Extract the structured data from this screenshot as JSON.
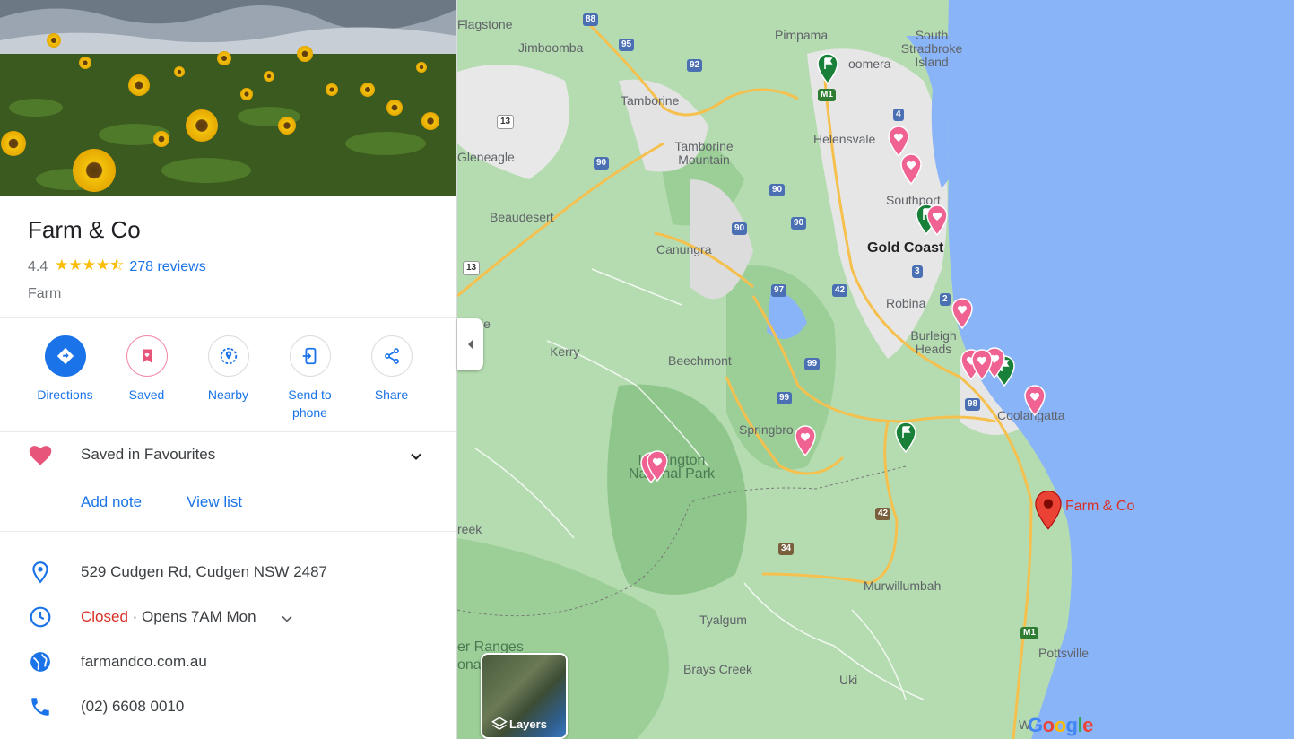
{
  "place": {
    "name": "Farm & Co",
    "rating": "4.4",
    "stars": "★★★★⯪",
    "reviews": "278 reviews",
    "category": "Farm"
  },
  "actions": [
    {
      "label": "Directions",
      "icon": "directions-icon"
    },
    {
      "label": "Saved",
      "icon": "bookmark-icon"
    },
    {
      "label": "Nearby",
      "icon": "nearby-icon"
    },
    {
      "label": "Send to phone",
      "icon": "send-to-phone-icon"
    },
    {
      "label": "Share",
      "icon": "share-icon"
    }
  ],
  "saved": {
    "label": "Saved in Favourites",
    "add_note": "Add note",
    "view_list": "View list"
  },
  "info": {
    "address": "529 Cudgen Rd, Cudgen NSW 2487",
    "hours_status": "Closed",
    "hours_detail": " · Opens 7AM Mon",
    "website": "farmandco.com.au",
    "phone": "(02) 6608 0010"
  },
  "map": {
    "labels": {
      "flagstone": "Flagstone",
      "jimboomba": "Jimboomba",
      "pimpama": "Pimpama",
      "coomera": "oomera",
      "south_stradbroke": "South Stradbroke Island",
      "tamborine": "Tamborine",
      "helensvale": "Helensvale",
      "tamborine_mountain": "Tamborine Mountain",
      "gleneagle": "Gleneagle",
      "southport": "Southport",
      "beaudesert": "Beaudesert",
      "canungra": "Canungra",
      "gold_coast": "Gold Coast",
      "robina": "Robina",
      "burleigh_heads": "Burleigh Heads",
      "kerry": "Kerry",
      "beechmont": "Beechmont",
      "coolangatta": "Coolangatta",
      "springbrook": "Springbro",
      "lamington": "Lamington National Park",
      "farm_and_co": "Farm & Co",
      "creek": "reek",
      "murwillumbah": "Murwillumbah",
      "tyalgum": "Tyalgum",
      "border_ranges": "er Ranges",
      "border_ranges2": "ona",
      "pottsville": "Pottsville",
      "brays_creek": "Brays Creek",
      "uki": "Uki",
      "wo": "W",
      "le": "le"
    },
    "shields": [
      "88",
      "95",
      "92",
      "13",
      "90",
      "90",
      "90",
      "90",
      "M1",
      "4",
      "3",
      "2",
      "97",
      "42",
      "99",
      "99",
      "98",
      "13",
      "42",
      "34",
      "M1"
    ],
    "layers_label": "Layers",
    "logo": "Google",
    "colors": {
      "land": "#a6d4a0",
      "water": "#8ab4f8",
      "urban": "#e8eaed",
      "road": "#f5c04e",
      "pin_red": "#ea4335",
      "pin_pink": "#f06292",
      "pin_green": "#188038"
    }
  }
}
